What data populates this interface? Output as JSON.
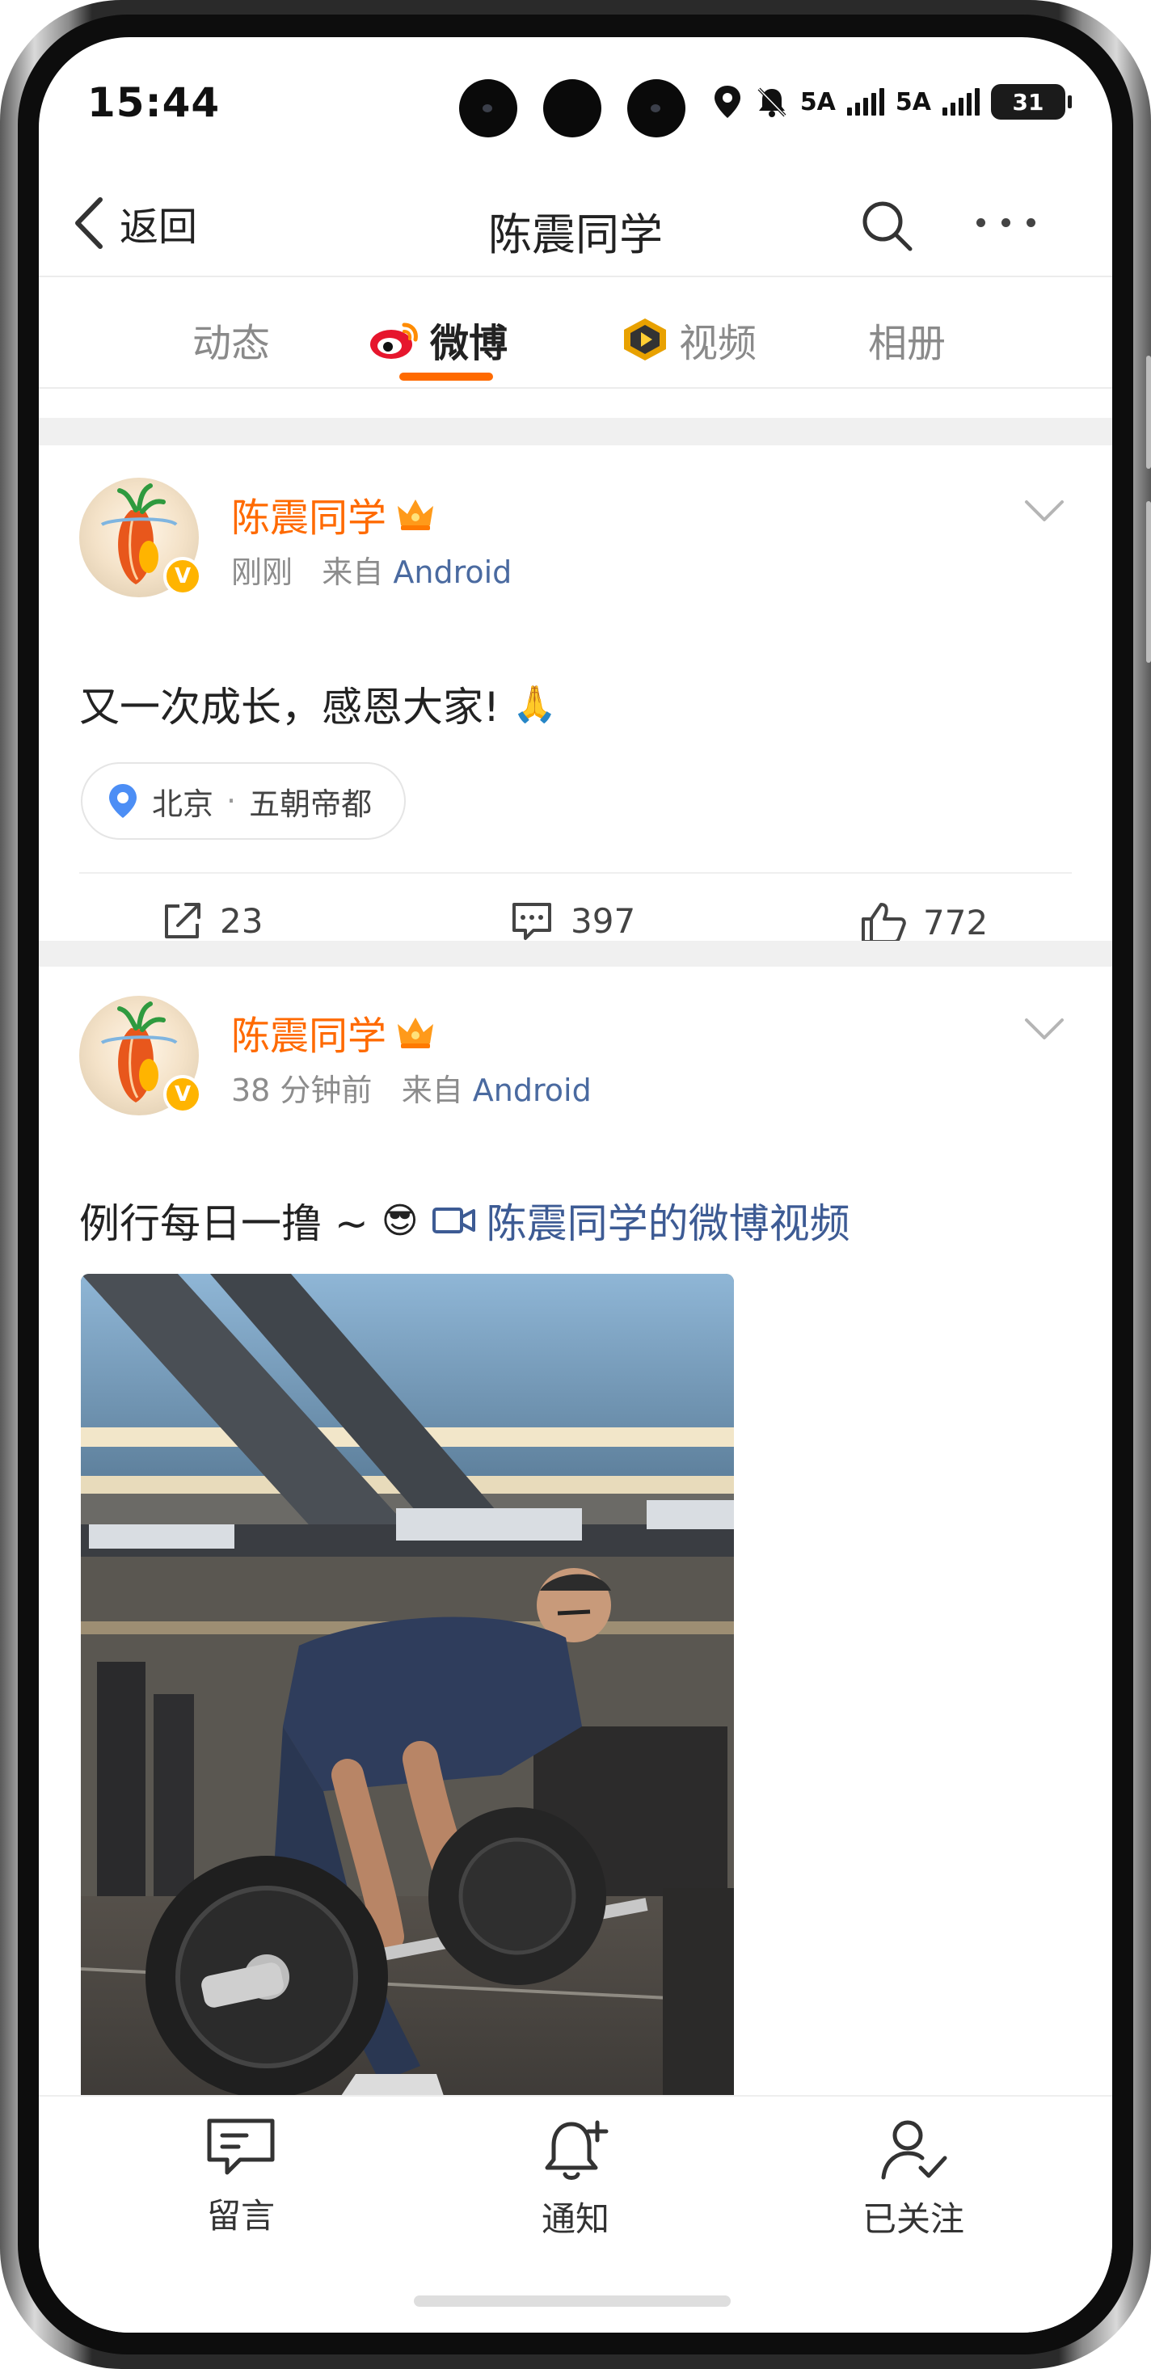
{
  "status_bar": {
    "time": "15:44",
    "net1": "5A",
    "net2": "5A",
    "battery": "31"
  },
  "nav": {
    "back_label": "返回",
    "title": "陈震同学"
  },
  "tabs": [
    {
      "label": "动态",
      "active": false
    },
    {
      "label": "微博",
      "active": true
    },
    {
      "label": "视频",
      "active": false
    },
    {
      "label": "相册",
      "active": false
    }
  ],
  "posts": [
    {
      "username": "陈震同学",
      "time": "刚刚",
      "from_prefix": "来自",
      "source": "Android",
      "text": "又一次成长，感恩大家!",
      "emoji": "🙏",
      "location": {
        "city": "北京",
        "tag": "五朝帝都"
      },
      "shares": "23",
      "comments": "397",
      "likes": "772"
    },
    {
      "username": "陈震同学",
      "time": "38 分钟前",
      "from_prefix": "来自",
      "source": "Android",
      "text": "例行每日一撸 ~",
      "emoji": "😎",
      "video_link": "陈震同学的微博视频"
    }
  ],
  "bottom_bar": {
    "message": "留言",
    "notify": "通知",
    "followed": "已关注"
  },
  "colors": {
    "accent": "#ff6a00",
    "link": "#3d5b94",
    "verified": "#ffb400"
  },
  "icons": [
    "back-chevron-icon",
    "search-icon",
    "more-icon",
    "weibo-logo-icon",
    "video-badge-icon",
    "location-pin-icon",
    "share-icon",
    "comment-icon",
    "like-icon",
    "message-icon",
    "bell-icon",
    "followed-icon"
  ]
}
